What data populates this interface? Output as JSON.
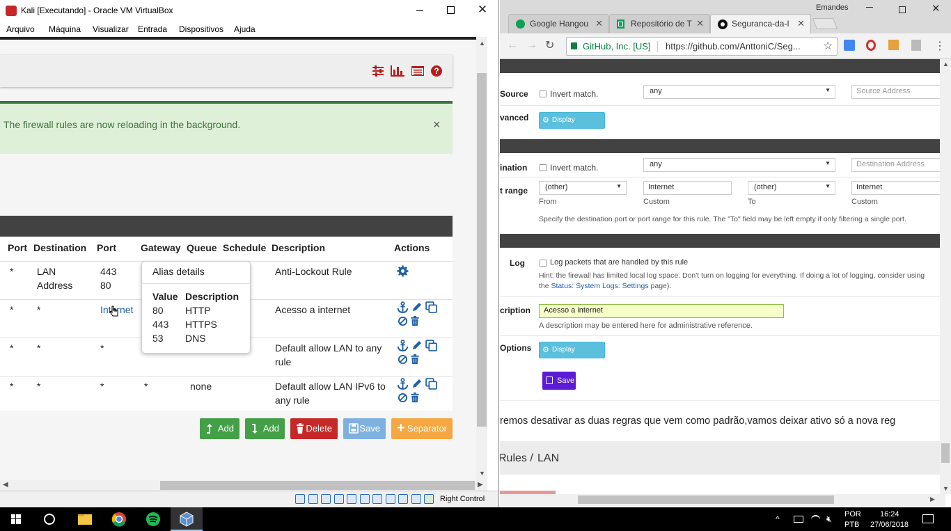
{
  "vbox": {
    "title": "Kali [Executando] - Oracle VM VirtualBox",
    "menu": [
      "Arquivo",
      "Máquina",
      "Visualizar",
      "Entrada",
      "Dispositivos",
      "Ajuda"
    ],
    "alert_message": "The firewall rules are now reloading in the background.",
    "alert_close": "×",
    "table": {
      "headers": [
        "Port",
        "Destination",
        "Port",
        "Gateway",
        "Queue",
        "Schedule",
        "Description",
        "Actions"
      ],
      "rows": [
        {
          "src_port": "*",
          "destination_l1": "LAN",
          "destination_l2": "Address",
          "port_l1": "443",
          "port_l2": "80",
          "gateway": "",
          "queue": "",
          "description_l1": "Anti-Lockout Rule",
          "description_l2": ""
        },
        {
          "src_port": "*",
          "destination_l1": "*",
          "destination_l2": "",
          "port_l1": "Internet",
          "port_l2": "",
          "gateway": "",
          "queue": "",
          "description_l1": "Acesso a internet",
          "description_l2": ""
        },
        {
          "src_port": "*",
          "destination_l1": "*",
          "destination_l2": "",
          "port_l1": "*",
          "port_l2": "",
          "gateway": "",
          "queue": "",
          "description_l1": "Default allow LAN to any",
          "description_l2": "rule"
        },
        {
          "src_port": "*",
          "destination_l1": "*",
          "destination_l2": "",
          "port_l1": "*",
          "port_l2": "",
          "gateway": "*",
          "queue": "none",
          "description_l1": "Default allow LAN IPv6 to",
          "description_l2": "any rule"
        }
      ]
    },
    "alias_popup": {
      "title": "Alias details",
      "col_value": "Value",
      "col_description": "Description",
      "items": [
        {
          "value": "80",
          "description": "HTTP"
        },
        {
          "value": "443",
          "description": "HTTPS"
        },
        {
          "value": "53",
          "description": "DNS"
        }
      ]
    },
    "buttons": {
      "add_top": "Add",
      "add_bottom": "Add",
      "delete": "Delete",
      "save": "Save",
      "separator": "Separator"
    },
    "status_right_control": "Right Control",
    "colors": {
      "add": "#43a047",
      "delete": "#c62828",
      "save": "#7fb1e0",
      "separator": "#f5a742",
      "action_icon": "#1e5fa8",
      "alert_bg": "#dff0d8"
    }
  },
  "chrome": {
    "user": "Emandes",
    "tabs": [
      {
        "title": "Google Hangou",
        "active": false
      },
      {
        "title": "Repositório de T",
        "active": false
      },
      {
        "title": "Seguranca-da-I",
        "active": true
      }
    ],
    "site_identity": "GitHub, Inc. [US]",
    "url": "https://github.com/AnttoniC/Seg...",
    "form": {
      "source_label": "Source",
      "invert_match": "Invert match.",
      "source_select": "any",
      "source_address_placeholder": "Source Address",
      "advanced_label": "vanced",
      "display_advanced": "Display Advanced",
      "destination_label": "ination",
      "destination_select": "any",
      "destination_address_placeholder": "Destination Address",
      "port_range_label": "t range",
      "from_select": "(other)",
      "from_custom": "Internet",
      "to_select": "(other)",
      "to_custom": "Internet",
      "from_caption": "From",
      "custom_caption": "Custom",
      "to_caption": "To",
      "custom_caption2": "Custom",
      "port_hint": "Specify the destination port or port range for this rule. The \"To\" field may be left empty if only filtering a single port.",
      "log_label": "Log",
      "log_checkbox": "Log packets that are handled by this rule",
      "log_hint_1": "Hint: the firewall has limited local log space. Don't turn on logging for everything. If doing a lot of logging, consider using",
      "log_hint_2a": "the ",
      "log_hint_link": "Status: System Logs: Settings",
      "log_hint_2b": " page).",
      "description_label": "cription",
      "description_value": "Acesso a internet",
      "description_hint": "A description may be entered here for administrative reference.",
      "options_label": "Options",
      "display_advanced_2": "Display Advanced",
      "save_button": "Save"
    },
    "article_text": "remos desativar as duas regras que vem como padrão,vamos deixar ativo só a nova reg",
    "breadcrumb_1": "Rules /",
    "breadcrumb_2": "LAN"
  },
  "taskbar": {
    "lang_1": "POR",
    "lang_2": "PTB",
    "time": "16:24",
    "date": "27/06/2018"
  }
}
